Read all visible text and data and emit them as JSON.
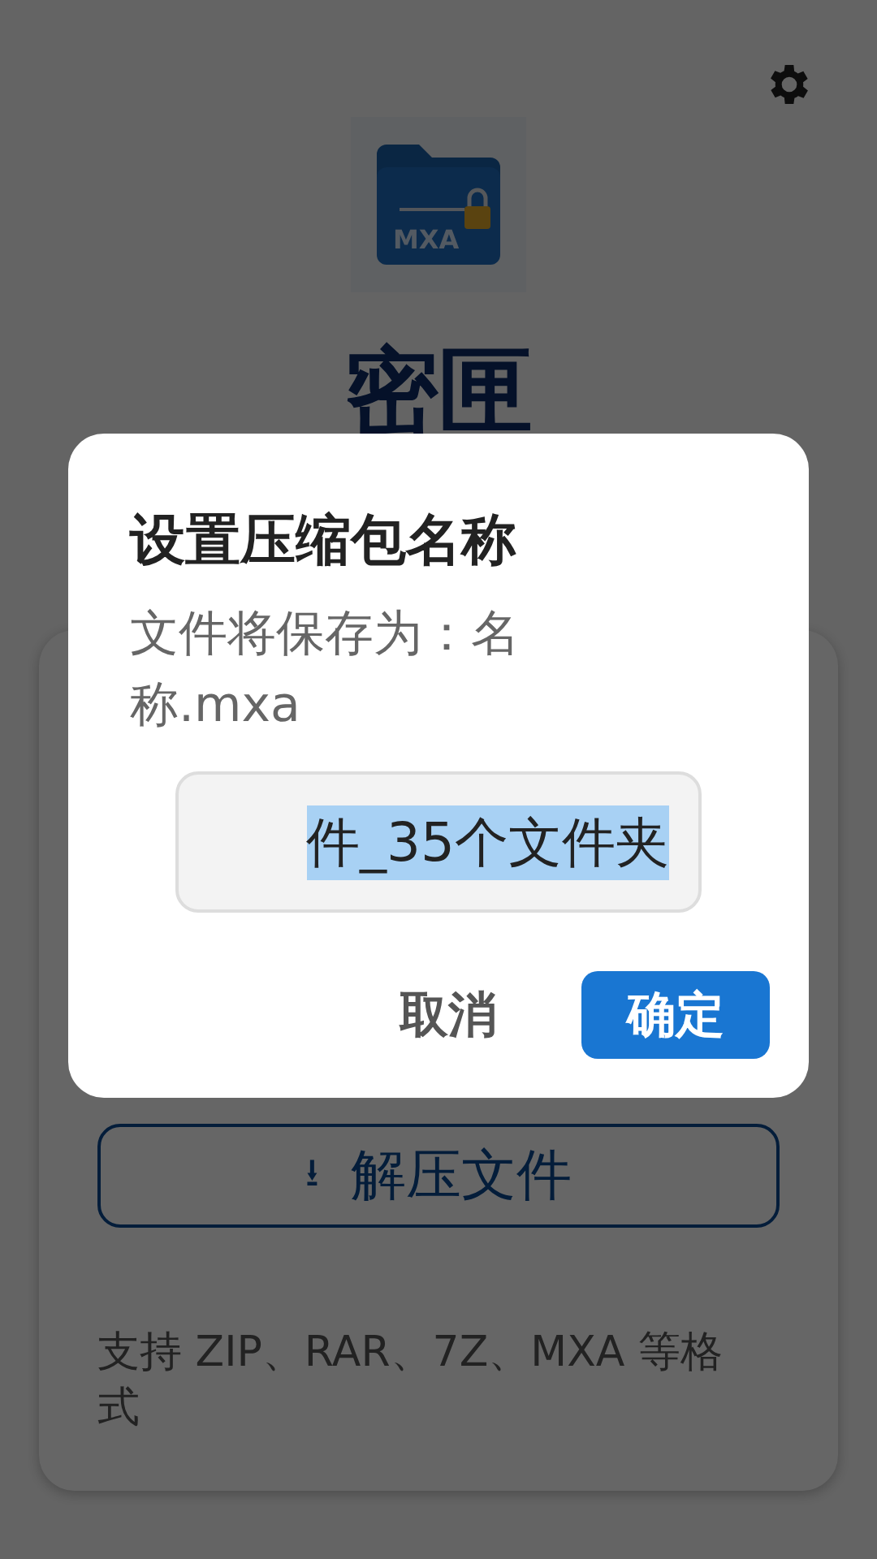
{
  "app": {
    "icon_label": "MXA",
    "title": "密匣",
    "extract_button": {
      "icon": "⭳",
      "label": "解压文件"
    },
    "support_note": "支持 ZIP、RAR、7Z、MXA 等格式"
  },
  "dialog": {
    "title": "设置压缩包名称",
    "message": "文件将保存为：名称.mxa",
    "name_field": {
      "value": "件_35个文件夹",
      "text_selected": true
    },
    "buttons": [
      {
        "label": "取消",
        "kind": "text"
      },
      {
        "label": "确定",
        "kind": "filled"
      }
    ]
  }
}
